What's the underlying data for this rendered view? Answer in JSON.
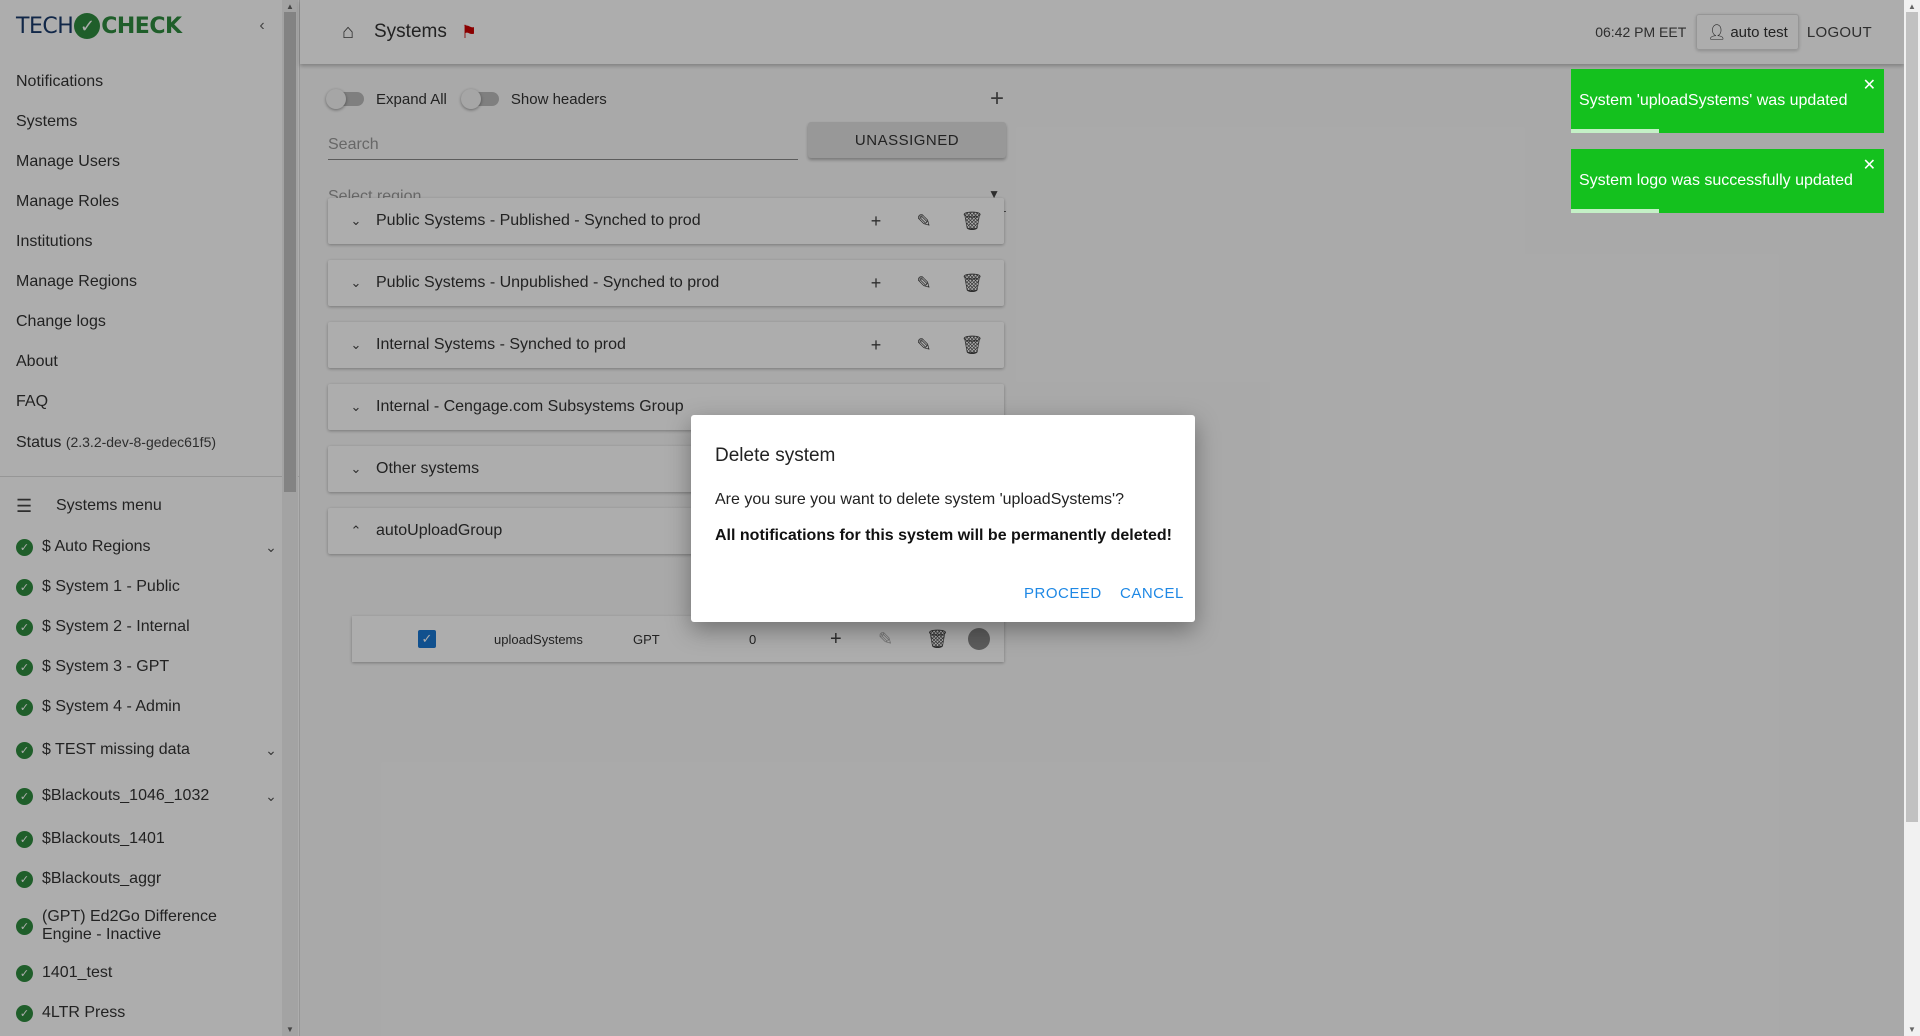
{
  "sidebar": {
    "logo": {
      "part1": "TECH",
      "part2": "CHECK"
    },
    "nav_items": [
      {
        "label": "Notifications"
      },
      {
        "label": "Systems"
      },
      {
        "label": "Manage Users"
      },
      {
        "label": "Manage Roles"
      },
      {
        "label": "Institutions"
      },
      {
        "label": "Manage Regions"
      },
      {
        "label": "Change logs"
      },
      {
        "label": "About"
      },
      {
        "label": "FAQ"
      }
    ],
    "status": {
      "label": "Status",
      "version": "(2.3.2-dev-8-gedec61f5)"
    },
    "systems_menu_label": "Systems menu",
    "systems": [
      {
        "label": "$ Auto Regions",
        "expandable": true
      },
      {
        "label": "$ System 1 - Public"
      },
      {
        "label": "$ System 2 - Internal"
      },
      {
        "label": "$ System 3 - GPT"
      },
      {
        "label": "$ System 4 - Admin"
      },
      {
        "label": "$ TEST missing data",
        "expandable": true
      },
      {
        "label": "$Blackouts_1046_1032",
        "expandable": true
      },
      {
        "label": "$Blackouts_1401"
      },
      {
        "label": "$Blackouts_aggr"
      },
      {
        "label": "(GPT) Ed2Go Difference Engine - Inactive"
      },
      {
        "label": "1401_test"
      },
      {
        "label": "4LTR Press"
      }
    ]
  },
  "header": {
    "title": "Systems",
    "time": "06:42 PM EET",
    "user": "auto test",
    "logout": "LOGOUT"
  },
  "toolbar": {
    "expand_all": "Expand All",
    "show_headers": "Show headers",
    "search_placeholder": "Search",
    "unassigned": "UNASSIGNED",
    "region_placeholder": "Select region"
  },
  "groups": [
    {
      "title": "Public Systems - Published - Synched to prod",
      "expanded": false
    },
    {
      "title": "Public Systems - Unpublished - Synched to prod",
      "expanded": false
    },
    {
      "title": "Internal Systems - Synched to prod",
      "expanded": false
    },
    {
      "title": "Internal - Cengage.com Subsystems Group",
      "expanded": false
    },
    {
      "title": "Other systems",
      "expanded": false
    },
    {
      "title": "autoUploadGroup",
      "expanded": true
    }
  ],
  "sub_row": {
    "name": "uploadSystems",
    "type": "GPT",
    "count": "0",
    "checked": true
  },
  "dialog": {
    "title": "Delete system",
    "message": "Are you sure you want to delete system 'uploadSystems'?",
    "warning": "All notifications for this system will be permanently deleted!",
    "proceed": "PROCEED",
    "cancel": "CANCEL"
  },
  "toasts": [
    {
      "message": "System 'uploadSystems' was updated",
      "color": "#14c11e"
    },
    {
      "message": "System logo was successfully updated",
      "color": "#14c11e"
    }
  ],
  "colors": {
    "accent": "#1e88e5",
    "status_ok": "#2e8b3e",
    "toast": "#14c11e",
    "flag": "#cc0000"
  }
}
